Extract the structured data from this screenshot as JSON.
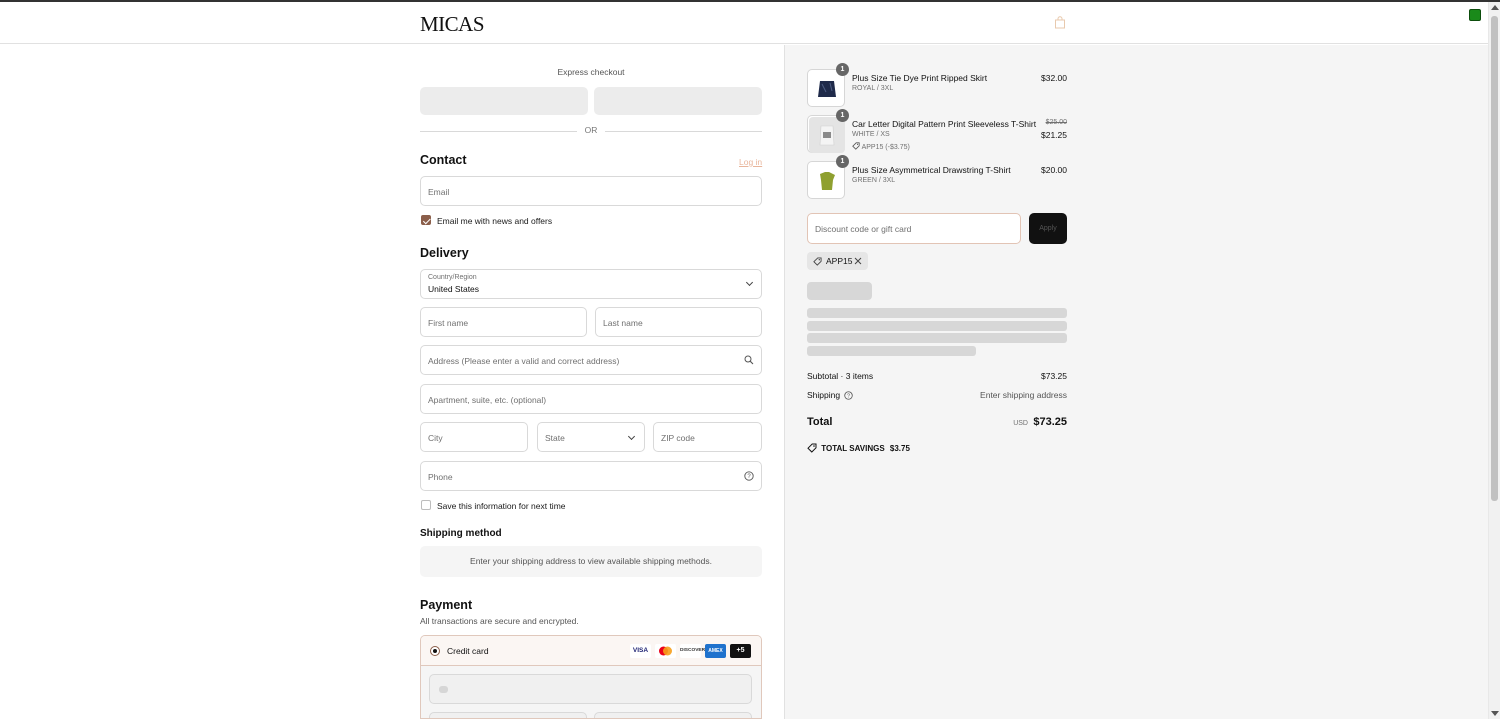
{
  "header": {
    "logo": "MICAS",
    "bag_icon": "shopping-bag-icon"
  },
  "express": {
    "label": "Express checkout",
    "or": "OR"
  },
  "contact": {
    "heading": "Contact",
    "login_link": "Log in",
    "email_placeholder": "Email",
    "newsletter_label": "Email me with news and offers",
    "newsletter_checked": true
  },
  "delivery": {
    "heading": "Delivery",
    "country_label": "Country/Region",
    "country_value": "United States",
    "first_name": "First name",
    "last_name": "Last name",
    "address": "Address (Please enter a valid and correct address)",
    "apartment": "Apartment, suite, etc. (optional)",
    "city": "City",
    "state": "State",
    "zip": "ZIP code",
    "phone": "Phone",
    "save_info_label": "Save this information for next time",
    "save_info_checked": false
  },
  "shipping": {
    "heading": "Shipping method",
    "message": "Enter your shipping address to view available shipping methods."
  },
  "payment": {
    "heading": "Payment",
    "subtitle": "All transactions are secure and encrypted.",
    "method_label": "Credit card",
    "cards": [
      "VISA",
      "mastercard",
      "DISCOVER",
      "AMEX"
    ],
    "more_cards": "+5"
  },
  "order": {
    "items": [
      {
        "qty": "1",
        "name": "Plus Size Tie Dye Print Ripped Skirt",
        "variant": "ROYAL / 3XL",
        "price": "$32.00",
        "original_price": "",
        "discount": ""
      },
      {
        "qty": "1",
        "name": "Car Letter Digital Pattern Print Sleeveless T-Shirt",
        "variant": "WHITE / XS",
        "price": "$21.25",
        "original_price": "$25.00",
        "discount": "APP15 (-$3.75)"
      },
      {
        "qty": "1",
        "name": "Plus Size Asymmetrical Drawstring T-Shirt",
        "variant": "GREEN / 3XL",
        "price": "$20.00",
        "original_price": "",
        "discount": ""
      }
    ],
    "discount_placeholder": "Discount code or gift card",
    "apply_label": "Apply",
    "applied_code": "APP15",
    "subtotal_label": "Subtotal · 3 items",
    "subtotal_value": "$73.25",
    "shipping_label": "Shipping",
    "shipping_value": "Enter shipping address",
    "total_label": "Total",
    "currency": "USD",
    "total_value": "$73.25",
    "savings_label": "TOTAL SAVINGS",
    "savings_value": "$3.75"
  },
  "colors": {
    "accent": "#8b5e4a",
    "link": "#e8b59b",
    "panel_bg": "#f5f5f5"
  }
}
